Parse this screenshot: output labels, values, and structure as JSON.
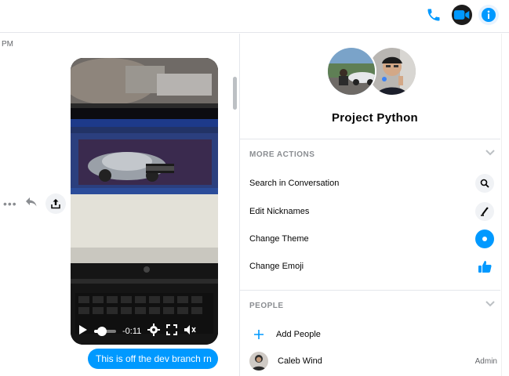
{
  "header": {
    "icons": [
      "phone-icon",
      "video-camera-icon",
      "info-icon"
    ],
    "accent_color": "#0099ff"
  },
  "chat": {
    "timestamp_fragment": "PM",
    "video": {
      "time_remaining": "-0:11",
      "progress": 0.35
    },
    "outgoing_message": "This is off the dev branch rn"
  },
  "sidebar": {
    "group_name": "Project Python",
    "more_actions": {
      "title": "MORE ACTIONS",
      "items": [
        {
          "label": "Search in Conversation",
          "icon": "search-icon"
        },
        {
          "label": "Edit Nicknames",
          "icon": "pencil-icon"
        },
        {
          "label": "Change Theme",
          "icon": "theme-icon"
        },
        {
          "label": "Change Emoji",
          "icon": "thumbs-up-icon"
        }
      ]
    },
    "people": {
      "title": "PEOPLE",
      "add_label": "Add People",
      "members": [
        {
          "name": "Caleb Wind",
          "role": "Admin"
        }
      ]
    }
  }
}
